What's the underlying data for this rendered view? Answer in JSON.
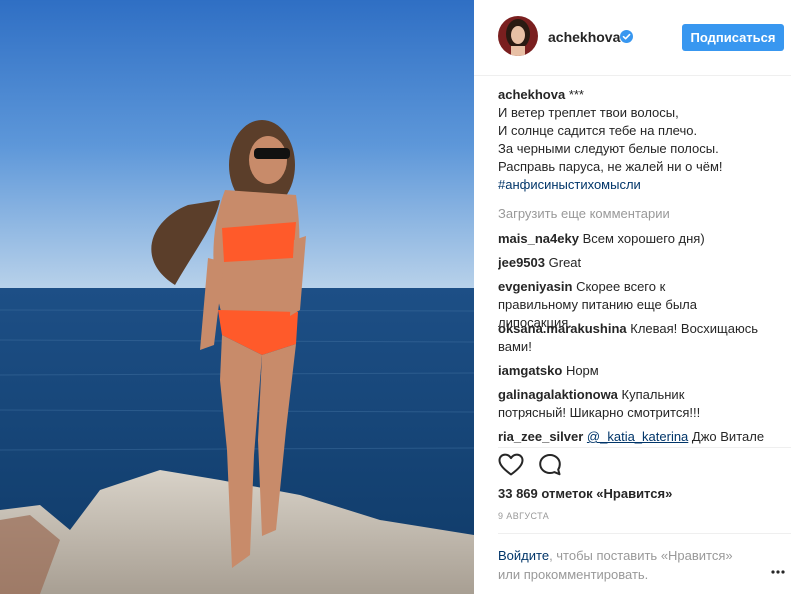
{
  "header": {
    "username": "achekhova",
    "follow_label": "Подписаться"
  },
  "caption": {
    "username": "achekhova",
    "suffix": " ***",
    "lines": [
      "И ветер треплет твои волосы,",
      "И солнце садится тебе на плечо.",
      "За черными следуют белые полосы.",
      "Расправь паруса, не жалей ни о чём!"
    ],
    "hashtag": "#анфисиныстихомысли"
  },
  "load_more": "Загрузить еще комментарии",
  "comments": [
    {
      "username": "mais_na4eky",
      "text": "Всем хорошего дня)"
    },
    {
      "username": "jee9503",
      "text": "Great"
    },
    {
      "username": "evgeniyasin",
      "text": "Скорее всего к правильному питанию еще была липосакция."
    },
    {
      "username": "oksana.marakushina",
      "text": "Клевая! Восхищаюсь вами!"
    },
    {
      "username": "iamgatsko",
      "text": "Норм"
    },
    {
      "username": "galinagalaktionowa",
      "text": "Купальник потрясный! Шикарно смотрится!!!"
    },
    {
      "username": "ria_zee_silver",
      "mention": "@_katia_katerina",
      "text": "Джо Витале"
    }
  ],
  "likes": "33 869 отметок «Нравится»",
  "date": "9 АВГУСТА",
  "login_prompt": {
    "link": "Войдите",
    "text": ", чтобы поставить «Нравится» или прокомментировать."
  },
  "icons": {
    "verified": "verified-badge-icon",
    "like": "heart-icon",
    "comment": "speech-bubble-icon",
    "more": "more-options-icon"
  },
  "colors": {
    "accent": "#3897f0",
    "link": "#003569",
    "muted": "#999999",
    "text": "#262626"
  }
}
